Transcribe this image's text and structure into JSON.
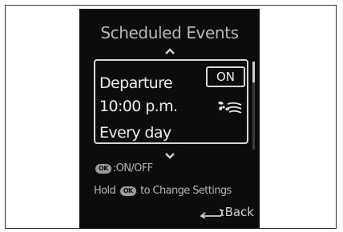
{
  "screen": {
    "title": "Scheduled Events",
    "event": {
      "name": "Departure",
      "time": "10:00 p.m.",
      "repeat": "Every day",
      "status": "ON",
      "mode_icon": "fan-defrost-icon"
    },
    "hints": {
      "ok_button": "OK",
      "toggle_text": ":ON/OFF",
      "hold_prefix": "Hold",
      "hold_suffix": "to Change Settings",
      "back_text": ":Back"
    },
    "colors": {
      "background": "#0c0c0c",
      "foreground": "#ededed",
      "muted": "#b3b3b3"
    }
  }
}
